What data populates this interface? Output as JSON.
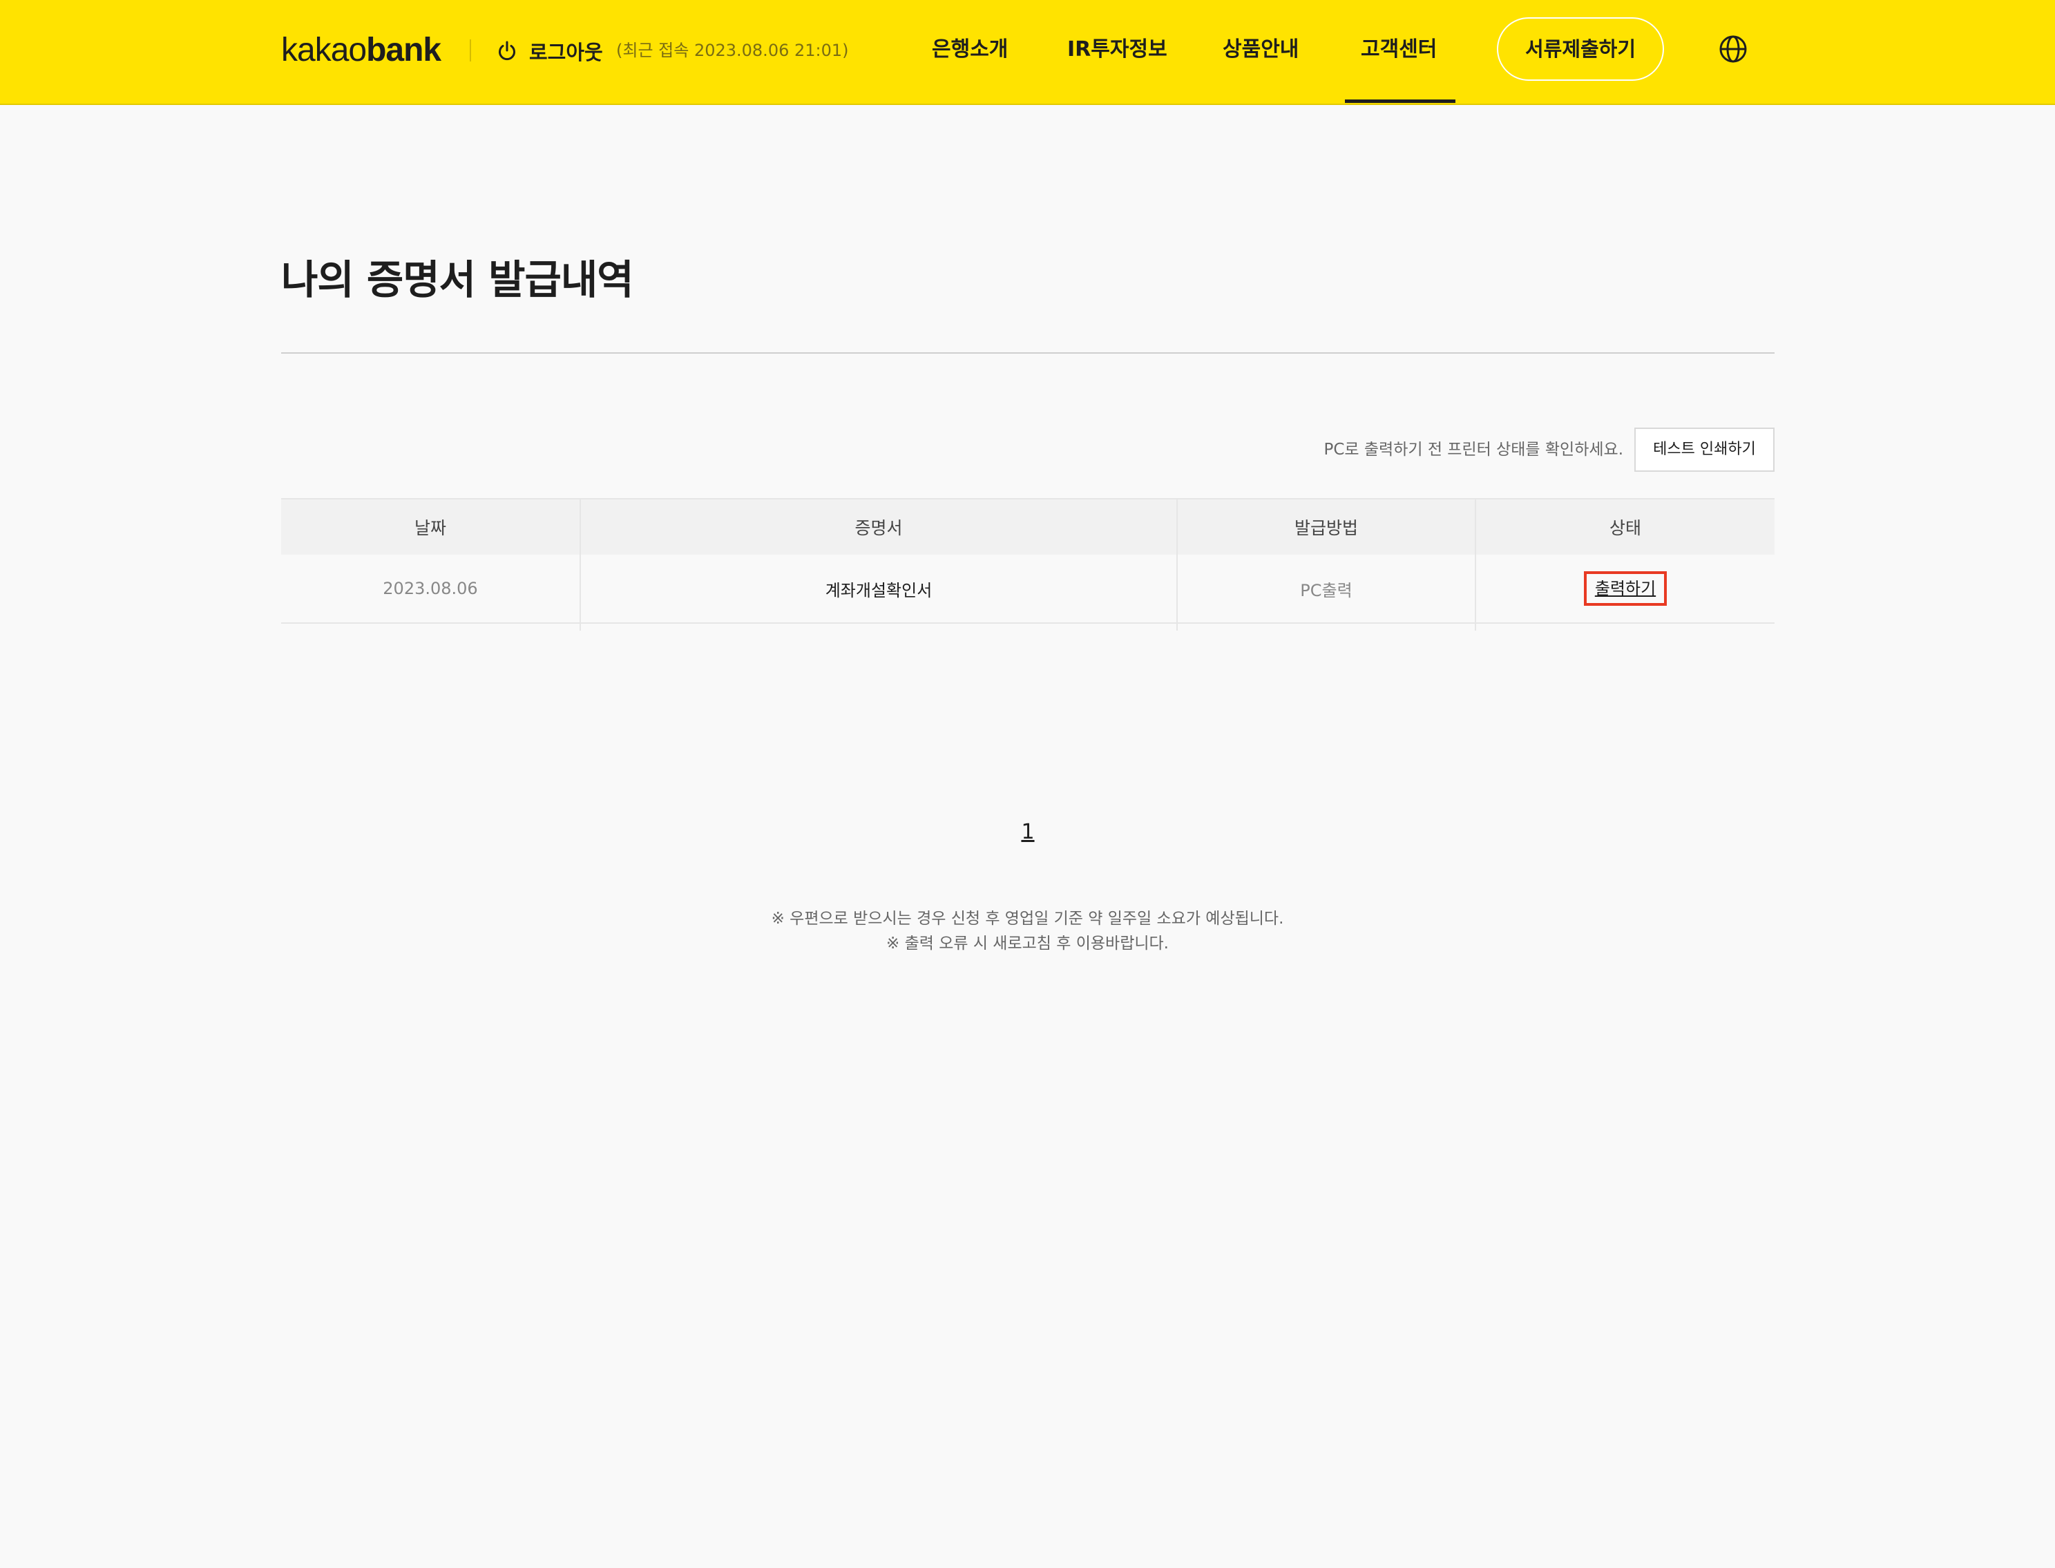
{
  "header": {
    "logo_regular": "kakao",
    "logo_bold": "bank",
    "logout_label": "로그아웃",
    "last_access": "(최근 접속 2023.08.06 21:01)",
    "nav": [
      "은행소개",
      "IR투자정보",
      "상품안내",
      "고객센터"
    ],
    "active_nav": "고객센터",
    "submit_button": "서류제출하기",
    "globe_icon": "globe-icon",
    "logout_icon": "power-icon",
    "brand_color": "#ffe300"
  },
  "main": {
    "title": "나의 증명서 발급내역",
    "printer_note": "PC로 출력하기 전 프린터 상태를 확인하세요.",
    "test_print_button": "테스트 인쇄하기",
    "table": {
      "headers": [
        "날짜",
        "증명서",
        "발급방법",
        "상태"
      ],
      "rows": [
        {
          "date": "2023.08.06",
          "certificate": "계좌개설확인서",
          "method": "PC출력",
          "status": "출력하기"
        }
      ]
    },
    "pagination": {
      "current_page": "1"
    },
    "footnotes": [
      "※ 우편으로 받으시는 경우 신청 후 영업일 기준 약 일주일 소요가 예상됩니다.",
      "※ 출력 오류 시 새로고침 후 이용바랍니다."
    ],
    "highlight_color": "#e83a23"
  }
}
